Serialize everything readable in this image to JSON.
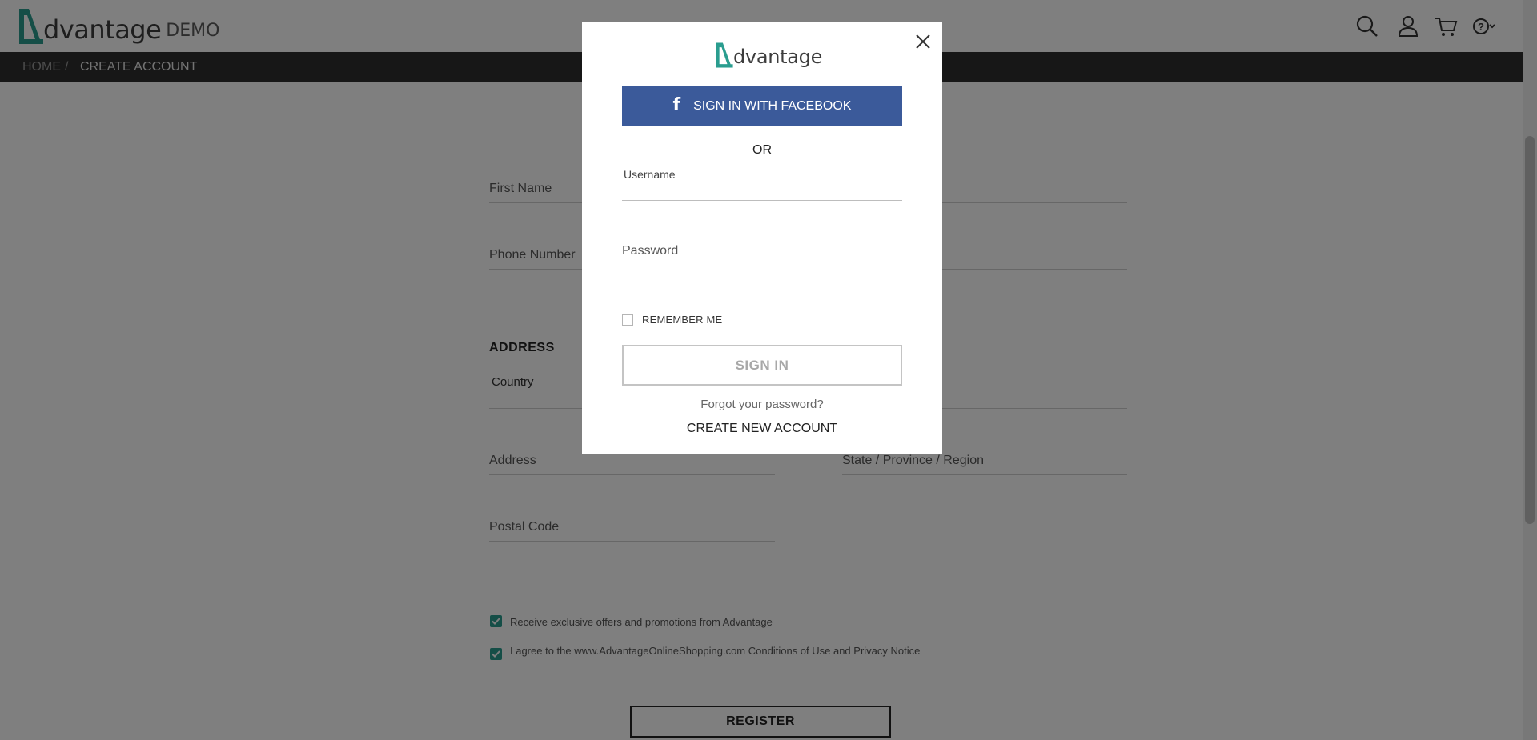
{
  "header": {
    "logo_text": "dvantage",
    "logo_suffix": "DEMO",
    "icons": [
      "search-icon",
      "user-icon",
      "cart-icon",
      "help-icon",
      "chevron-down-icon"
    ]
  },
  "breadcrumb": {
    "home": "HOME",
    "separator": "/",
    "current": "CREATE ACCOUNT"
  },
  "form": {
    "first_name": "First Name",
    "phone_number": "Phone Number",
    "address_section": "ADDRESS",
    "country": "Country",
    "address": "Address",
    "state": "State / Province / Region",
    "postal_code": "Postal Code",
    "offers_label": "Receive exclusive offers and promotions from Advantage",
    "agree_label": "I agree to the www.AdvantageOnlineShopping.com Conditions of Use and Privacy Notice",
    "register": "REGISTER"
  },
  "modal": {
    "logo_text": "dvantage",
    "facebook_button": "SIGN IN WITH FACEBOOK",
    "facebook_glyph": "f",
    "or": "OR",
    "username_label": "Username",
    "password_label": "Password",
    "remember_me": "REMEMBER ME",
    "sign_in": "SIGN IN",
    "forgot_password": "Forgot your password?",
    "create_account": "CREATE NEW ACCOUNT"
  },
  "colors": {
    "accent": "#2a9d8f",
    "facebook": "#3b5a9a",
    "breadcrumb_bg": "#2f2f2f"
  }
}
